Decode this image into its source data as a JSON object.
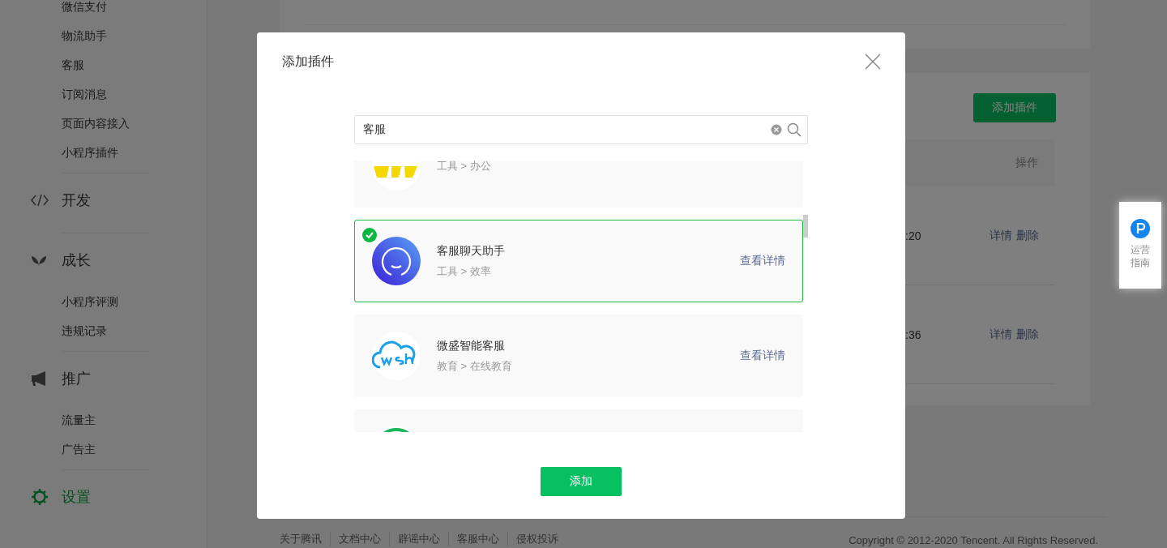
{
  "sidebar": {
    "groups": [
      {
        "items": [
          {
            "label": "微信支付",
            "selected": false
          },
          {
            "label": "物流助手",
            "selected": false
          },
          {
            "label": "客服",
            "selected": false
          },
          {
            "label": "订阅消息",
            "selected": false
          },
          {
            "label": "页面内容接入",
            "selected": false
          },
          {
            "label": "小程序插件",
            "selected": false
          }
        ]
      },
      {
        "label": "开发",
        "selected": false
      },
      {
        "label": "成长",
        "selected": false,
        "items": [
          {
            "label": "小程序评测",
            "selected": false
          },
          {
            "label": "违规记录",
            "selected": false
          }
        ]
      },
      {
        "label": "推广",
        "selected": false,
        "items": [
          {
            "label": "流量主",
            "selected": false
          },
          {
            "label": "广告主",
            "selected": false
          }
        ]
      },
      {
        "label": "设置",
        "selected": true
      }
    ]
  },
  "page": {
    "add_button": "添加插件",
    "table": {
      "columns": [
        "操作"
      ],
      "rows": [
        {
          "column_1": ":20",
          "actions": [
            "详情",
            "删除"
          ]
        },
        {
          "column_1": ":36",
          "actions": [
            "详情",
            "删除"
          ]
        }
      ]
    }
  },
  "footer": {
    "links": [
      "关于腾讯",
      "文档中心",
      "辟谣中心",
      "客服中心",
      "侵权投诉"
    ],
    "copyright": "Copyright © 2012-2020 Tencent. All Rights Reserved."
  },
  "guide_widget": {
    "label": "运营指南"
  },
  "dialog": {
    "title": "添加插件",
    "search": {
      "value": "客服"
    },
    "plugins": [
      {
        "category": "工具 > 办公",
        "selected": false
      },
      {
        "title": "客服聊天助手",
        "category": "工具 > 效率",
        "link": "查看详情",
        "selected": true
      },
      {
        "title": "微盛智能客服",
        "category": "教育 > 在线教育",
        "link": "查看详情",
        "selected": false
      },
      {
        "selected": false
      }
    ],
    "confirm_button": "添加"
  }
}
